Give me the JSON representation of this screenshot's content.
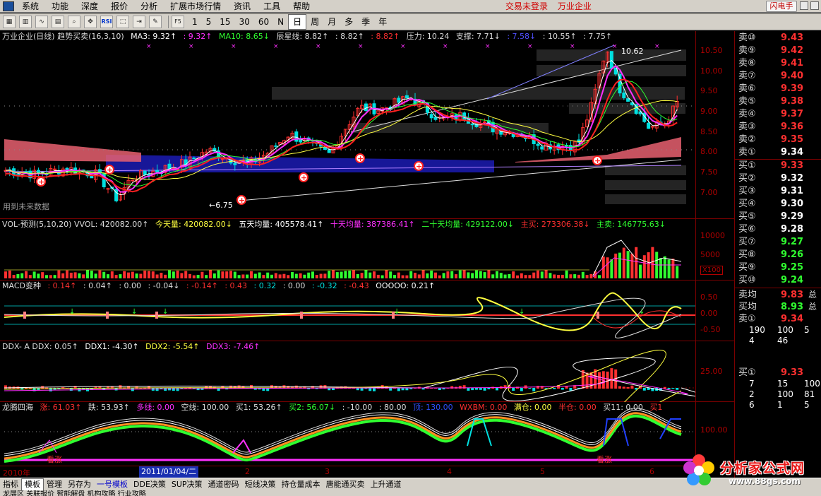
{
  "menubar": {
    "items": [
      "系统",
      "功能",
      "深度",
      "报价",
      "分析",
      "扩展市场行情",
      "资讯",
      "工具",
      "帮助"
    ],
    "status_login": "交易未登录",
    "status_stock": "万业企业",
    "flash_button": "闪电手"
  },
  "toolbar": {
    "icons": [
      "grid-icon",
      "chart-icon",
      "line-icon",
      "table-icon",
      "zoom-icon",
      "move-icon",
      "RSI",
      "select-icon",
      "jump-icon",
      "draw-icon"
    ],
    "rsi_label": "RSI",
    "f5_label": "F5",
    "periods": [
      "1",
      "5",
      "15",
      "30",
      "60",
      "N",
      "日",
      "周",
      "月",
      "多",
      "季",
      "年"
    ],
    "active_period": "日"
  },
  "main_pane": {
    "title": "万业企业(日线) 趋势买卖(16,3,10)",
    "ma3": "MA3: 9.32↑",
    "ma3b": ": 9.32↑",
    "ma10": "MA10: 8.65↓",
    "chenxing": "辰星线: 8.82↑",
    "v882b": ": 8.82↑",
    "v882c": ": 8.82↑",
    "pressure": "压力: 10.24",
    "support": "支撑: 7.71↓",
    "v758": ": 7.58↓",
    "v1055": ": 10.55↑",
    "v775": ": 7.75↑",
    "high_label": "10.62",
    "low_label": "←6.75",
    "future_label": "用到未来数据",
    "axis": [
      "10.50",
      "10.00",
      "9.50",
      "9.00",
      "8.50",
      "8.00",
      "7.50",
      "7.00"
    ]
  },
  "vol_pane": {
    "title": "VOL-预测(5,10,20) VVOL: 420082.00↑",
    "today": "今天量: 420082.00↓",
    "ma5": "五天均量: 405578.41↑",
    "ma10": "十天均量: 387386.41↑",
    "ma20": "二十天均量: 429122.00↓",
    "buy": "主买: 273306.38↓",
    "sell": "主卖: 146775.63↓",
    "axis": [
      "10000",
      "5000"
    ],
    "unit": "X100"
  },
  "macd_pane": {
    "title": "MACD变种",
    "v1": ": 0.14↑",
    "v2": ": 0.04↑",
    "v3": ": 0.00",
    "v4": ": -0.04↓",
    "v5": ": -0.14↑",
    "v6": ": 0.43",
    "v7": ": 0.32",
    "v8": ": 0.00",
    "v9": ": -0.32",
    "v10": ": -0.43",
    "v11": "OOOOO: 0.21↑",
    "axis": [
      "0.50",
      "0.00",
      "-0.50"
    ]
  },
  "ddx_pane": {
    "title": "DDX- A DDX: 0.05↑",
    "ddx1": "DDX1: -4.30↑",
    "ddx2": "DDX2: -5.54↑",
    "ddx3": "DDX3: -7.46↑",
    "axis": [
      "25.00"
    ]
  },
  "lt_pane": {
    "title": "龙腾四海",
    "rise": "涨: 61.03↑",
    "fall": "跌: 53.93↑",
    "long_line": "多线: 0.00",
    "short_line": "空线: 100.00",
    "buy1": "买1: 53.26↑",
    "buy2": "买2: 56.07↓",
    "v3": ": -10.00",
    "v4": ": 80.00",
    "top": "顶: 130.00",
    "wxbm": "WXBM: 0.00",
    "full": "满仓: 0.00",
    "half": "半仓: 0.00",
    "buy11": "买11: 0.00",
    "buy1b": "买1",
    "axis": [
      "100.00"
    ],
    "tag1": "看涨",
    "tag2": "看涨"
  },
  "datebar": {
    "ticks": [
      "2010年",
      "2",
      "3",
      "4",
      "5",
      "6"
    ],
    "cursor": "2011/01/04/二"
  },
  "quote": {
    "asks": [
      {
        "label": "卖⑩",
        "price": "9.43"
      },
      {
        "label": "卖⑨",
        "price": "9.42"
      },
      {
        "label": "卖⑧",
        "price": "9.41"
      },
      {
        "label": "卖⑦",
        "price": "9.40"
      },
      {
        "label": "卖⑥",
        "price": "9.39"
      },
      {
        "label": "卖⑤",
        "price": "9.38"
      },
      {
        "label": "卖④",
        "price": "9.37"
      },
      {
        "label": "卖③",
        "price": "9.36"
      },
      {
        "label": "卖②",
        "price": "9.35"
      },
      {
        "label": "卖①",
        "price": "9.34"
      }
    ],
    "bids": [
      {
        "label": "买①",
        "price": "9.33"
      },
      {
        "label": "买②",
        "price": "9.32"
      },
      {
        "label": "买③",
        "price": "9.31"
      },
      {
        "label": "买④",
        "price": "9.30"
      },
      {
        "label": "买⑤",
        "price": "9.29"
      },
      {
        "label": "买⑥",
        "price": "9.28"
      },
      {
        "label": "买⑦",
        "price": "9.27"
      },
      {
        "label": "买⑧",
        "price": "9.26"
      },
      {
        "label": "买⑨",
        "price": "9.25"
      },
      {
        "label": "买⑩",
        "price": "9.24"
      }
    ],
    "avg_sell_label": "卖均",
    "avg_sell": "9.83",
    "avg_sell_tail": "总",
    "avg_buy_label": "买均",
    "avg_buy": "8.93",
    "avg_buy_tail": "总",
    "sell1_label": "卖①",
    "sell1": "9.34",
    "row_a": [
      "190",
      "100",
      "5"
    ],
    "row_b": [
      "4",
      "46"
    ],
    "buy1_label": "买①",
    "buy1": "9.33",
    "row_c": [
      "7",
      "15",
      "100"
    ],
    "row_d": [
      "2",
      "100",
      "81"
    ],
    "row_e": [
      "6",
      "1",
      "5"
    ]
  },
  "bottombar": {
    "items": [
      "指标",
      "模板",
      "管理",
      "另存为",
      "一号模板",
      "DDE决策",
      "SUP决策",
      "通道密码",
      "短线决策",
      "持仓量成本",
      "唐能通买卖",
      "上升通道"
    ],
    "active": "模板",
    "highlight": "一号模板"
  },
  "statusline": "龙展区  关联报价  智能解盘  机构攻略  行业攻略",
  "logo": {
    "brand": "分析家公式网",
    "url": "www.88gs.com"
  },
  "colors": {
    "up": "#ff3030",
    "down": "#00e0e0",
    "axis": "#b00000",
    "magenta": "#ff30ff",
    "yellow": "#ffff40"
  }
}
